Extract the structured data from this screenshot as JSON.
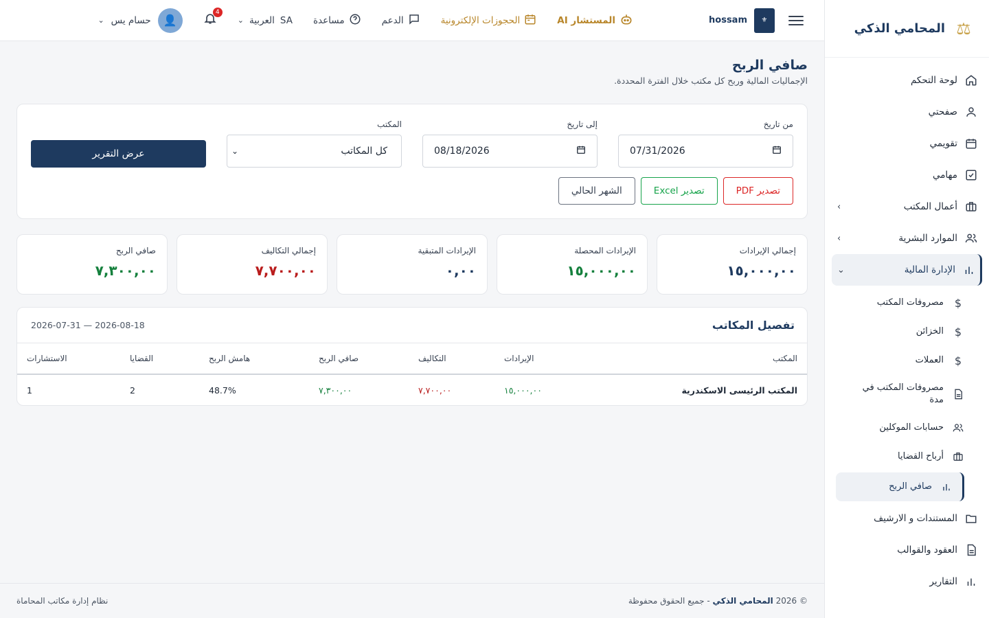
{
  "brand": {
    "name": "المحامي الذكي",
    "logo_icon": "scales-icon"
  },
  "topbar": {
    "firm_name": "hossam",
    "ai_label": "المستشار AI",
    "booking_label": "الحجوزات الإلكترونية",
    "support_label": "الدعم",
    "help_label": "مساعدة",
    "lang_code": "SA",
    "lang_label": "العربية",
    "notifications_count": "4",
    "user_name": "حسام يس"
  },
  "sidebar": {
    "items": [
      {
        "label": "لوحة التحكم",
        "icon": "home-icon"
      },
      {
        "label": "صفحتي",
        "icon": "user-icon"
      },
      {
        "label": "تقويمي",
        "icon": "calendar-icon"
      },
      {
        "label": "مهامي",
        "icon": "checkbox-icon"
      },
      {
        "label": "أعمال المكتب",
        "icon": "briefcase-icon"
      },
      {
        "label": "الموارد البشرية",
        "icon": "users-icon"
      },
      {
        "label": "الإدارة المالية",
        "icon": "bar-chart-icon"
      }
    ],
    "finance_sub": [
      {
        "label": "مصروفات المكتب",
        "icon": "dollar-icon"
      },
      {
        "label": "الخزائن",
        "icon": "dollar-icon"
      },
      {
        "label": "العملات",
        "icon": "dollar-icon"
      },
      {
        "label": "مصروفات المكتب في مدة",
        "icon": "document-icon"
      },
      {
        "label": "حسابات الموكلين",
        "icon": "users-icon"
      },
      {
        "label": "أرباح القضايا",
        "icon": "briefcase-icon"
      },
      {
        "label": "صافي الربح",
        "icon": "bar-chart-icon"
      }
    ],
    "bottom": [
      {
        "label": "المستندات و الارشيف",
        "icon": "folder-icon"
      },
      {
        "label": "العقود والقوالب",
        "icon": "document-icon"
      },
      {
        "label": "التقارير",
        "icon": "bar-chart-icon"
      }
    ]
  },
  "page": {
    "title": "صافي الربح",
    "subtitle": "الإجماليات المالية وربح كل مكتب خلال الفترة المحددة."
  },
  "filters": {
    "from_label": "من تاريخ",
    "from_value": "07/31/2026",
    "to_label": "إلى تاريخ",
    "to_value": "08/18/2026",
    "office_label": "المكتب",
    "office_value": "كل المكاتب",
    "show_report": "عرض التقرير",
    "export_pdf": "تصدير PDF",
    "export_excel": "تصدير Excel",
    "current_month": "الشهر الحالي"
  },
  "stats": [
    {
      "label": "إجمالي الإيرادات",
      "value": "١٥,٠٠٠,٠٠",
      "color": "#1e3a5f"
    },
    {
      "label": "الإيرادات المحصلة",
      "value": "١٥,٠٠٠,٠٠",
      "color": "#15803d"
    },
    {
      "label": "الإيرادات المتبقية",
      "value": "٠,٠٠",
      "color": "#1e3a5f"
    },
    {
      "label": "إجمالي التكاليف",
      "value": "٧,٧٠٠,٠٠",
      "color": "#b91c1c"
    },
    {
      "label": "صافي الربح",
      "value": "٧,٣٠٠,٠٠",
      "color": "#15803d"
    }
  ],
  "breakdown": {
    "title": "تفصيل المكاتب",
    "range": "2026-07-31 — 2026-08-18",
    "columns": [
      "المكتب",
      "الإيرادات",
      "التكاليف",
      "صافي الربح",
      "هامش الربح",
      "القضايا",
      "الاستشارات"
    ],
    "rows": [
      [
        "المكتب الرئيسى الاسكندرية",
        "١٥,٠٠٠,٠٠",
        "٧,٧٠٠,٠٠",
        "٧,٣٠٠,٠٠",
        "48.7%",
        "2",
        "1"
      ]
    ]
  },
  "footer": {
    "copyright_prefix": "© 2026",
    "brand": "المحامي الذكي",
    "rights": "- جميع الحقوق محفوظة",
    "system": "نظام إدارة مكاتب المحاماة"
  }
}
